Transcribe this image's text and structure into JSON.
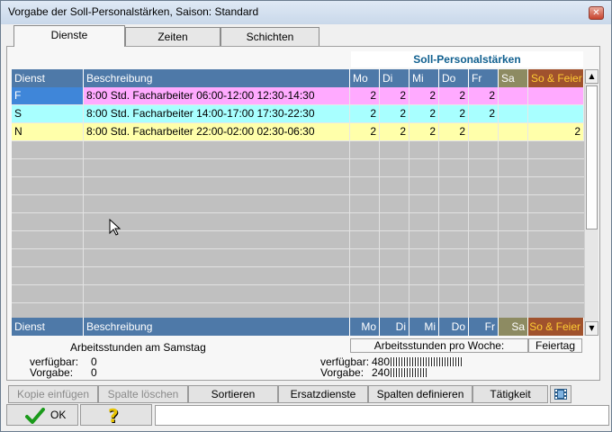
{
  "window": {
    "title": "Vorgabe der Soll-Personalstärken, Saison: Standard"
  },
  "tabs": [
    {
      "label": "Dienste",
      "active": true
    },
    {
      "label": "Zeiten",
      "active": false
    },
    {
      "label": "Schichten",
      "active": false
    }
  ],
  "soll_title": "Soll-Personalstärken",
  "columns": {
    "dienst": "Dienst",
    "beschreibung": "Beschreibung",
    "days": [
      "Mo",
      "Di",
      "Mi",
      "Do",
      "Fr",
      "Sa",
      "So & Feier"
    ]
  },
  "rows": [
    {
      "code": "F",
      "desc": "8:00 Std.  Facharbeiter 06:00-12:00 12:30-14:30",
      "values": [
        "2",
        "2",
        "2",
        "2",
        "2",
        "",
        ""
      ],
      "color": "#ffaaff",
      "code_bg": "#3f86d9",
      "code_color": "#ffffff"
    },
    {
      "code": "S",
      "desc": "8:00 Std.  Facharbeiter 14:00-17:00 17:30-22:30",
      "values": [
        "2",
        "2",
        "2",
        "2",
        "2",
        "",
        ""
      ],
      "color": "#a8ffff",
      "code_bg": "#a8ffff",
      "code_color": "#000000"
    },
    {
      "code": "N",
      "desc": "8:00 Std.  Facharbeiter 22:00-02:00 02:30-06:30",
      "values": [
        "2",
        "2",
        "2",
        "2",
        "",
        "",
        "2"
      ],
      "color": "#ffffaa",
      "code_bg": "#ffffaa",
      "code_color": "#000000"
    }
  ],
  "summary": {
    "samstag_title": "Arbeitsstunden am Samstag",
    "verfuegbar_label": "verfügbar:",
    "vorgabe_label": "Vorgabe:",
    "samstag_verfuegbar": "0",
    "samstag_vorgabe": "0",
    "woche_title": "Arbeitsstunden pro Woche:",
    "feiertag_title": "Feiertag",
    "woche_verfuegbar": "480",
    "woche_vorgabe": "240"
  },
  "buttons": {
    "kopie": "Kopie einfügen",
    "spalte": "Spalte löschen",
    "sortieren": "Sortieren",
    "ersatz": "Ersatzdienste",
    "spalten_def": "Spalten definieren",
    "taetigkeit": "Tätigkeit",
    "ok": "OK",
    "help": "?"
  },
  "colors": {
    "header": "#4e79a8",
    "sa_header": "#8d8b62",
    "so_header": "#a0522d",
    "so_text": "#ffcc33",
    "title_blue": "#0f5f8f"
  },
  "icons": {
    "close": "close-icon",
    "ok": "checkmark-icon",
    "help": "question-mark-icon",
    "film": "film-icon"
  }
}
